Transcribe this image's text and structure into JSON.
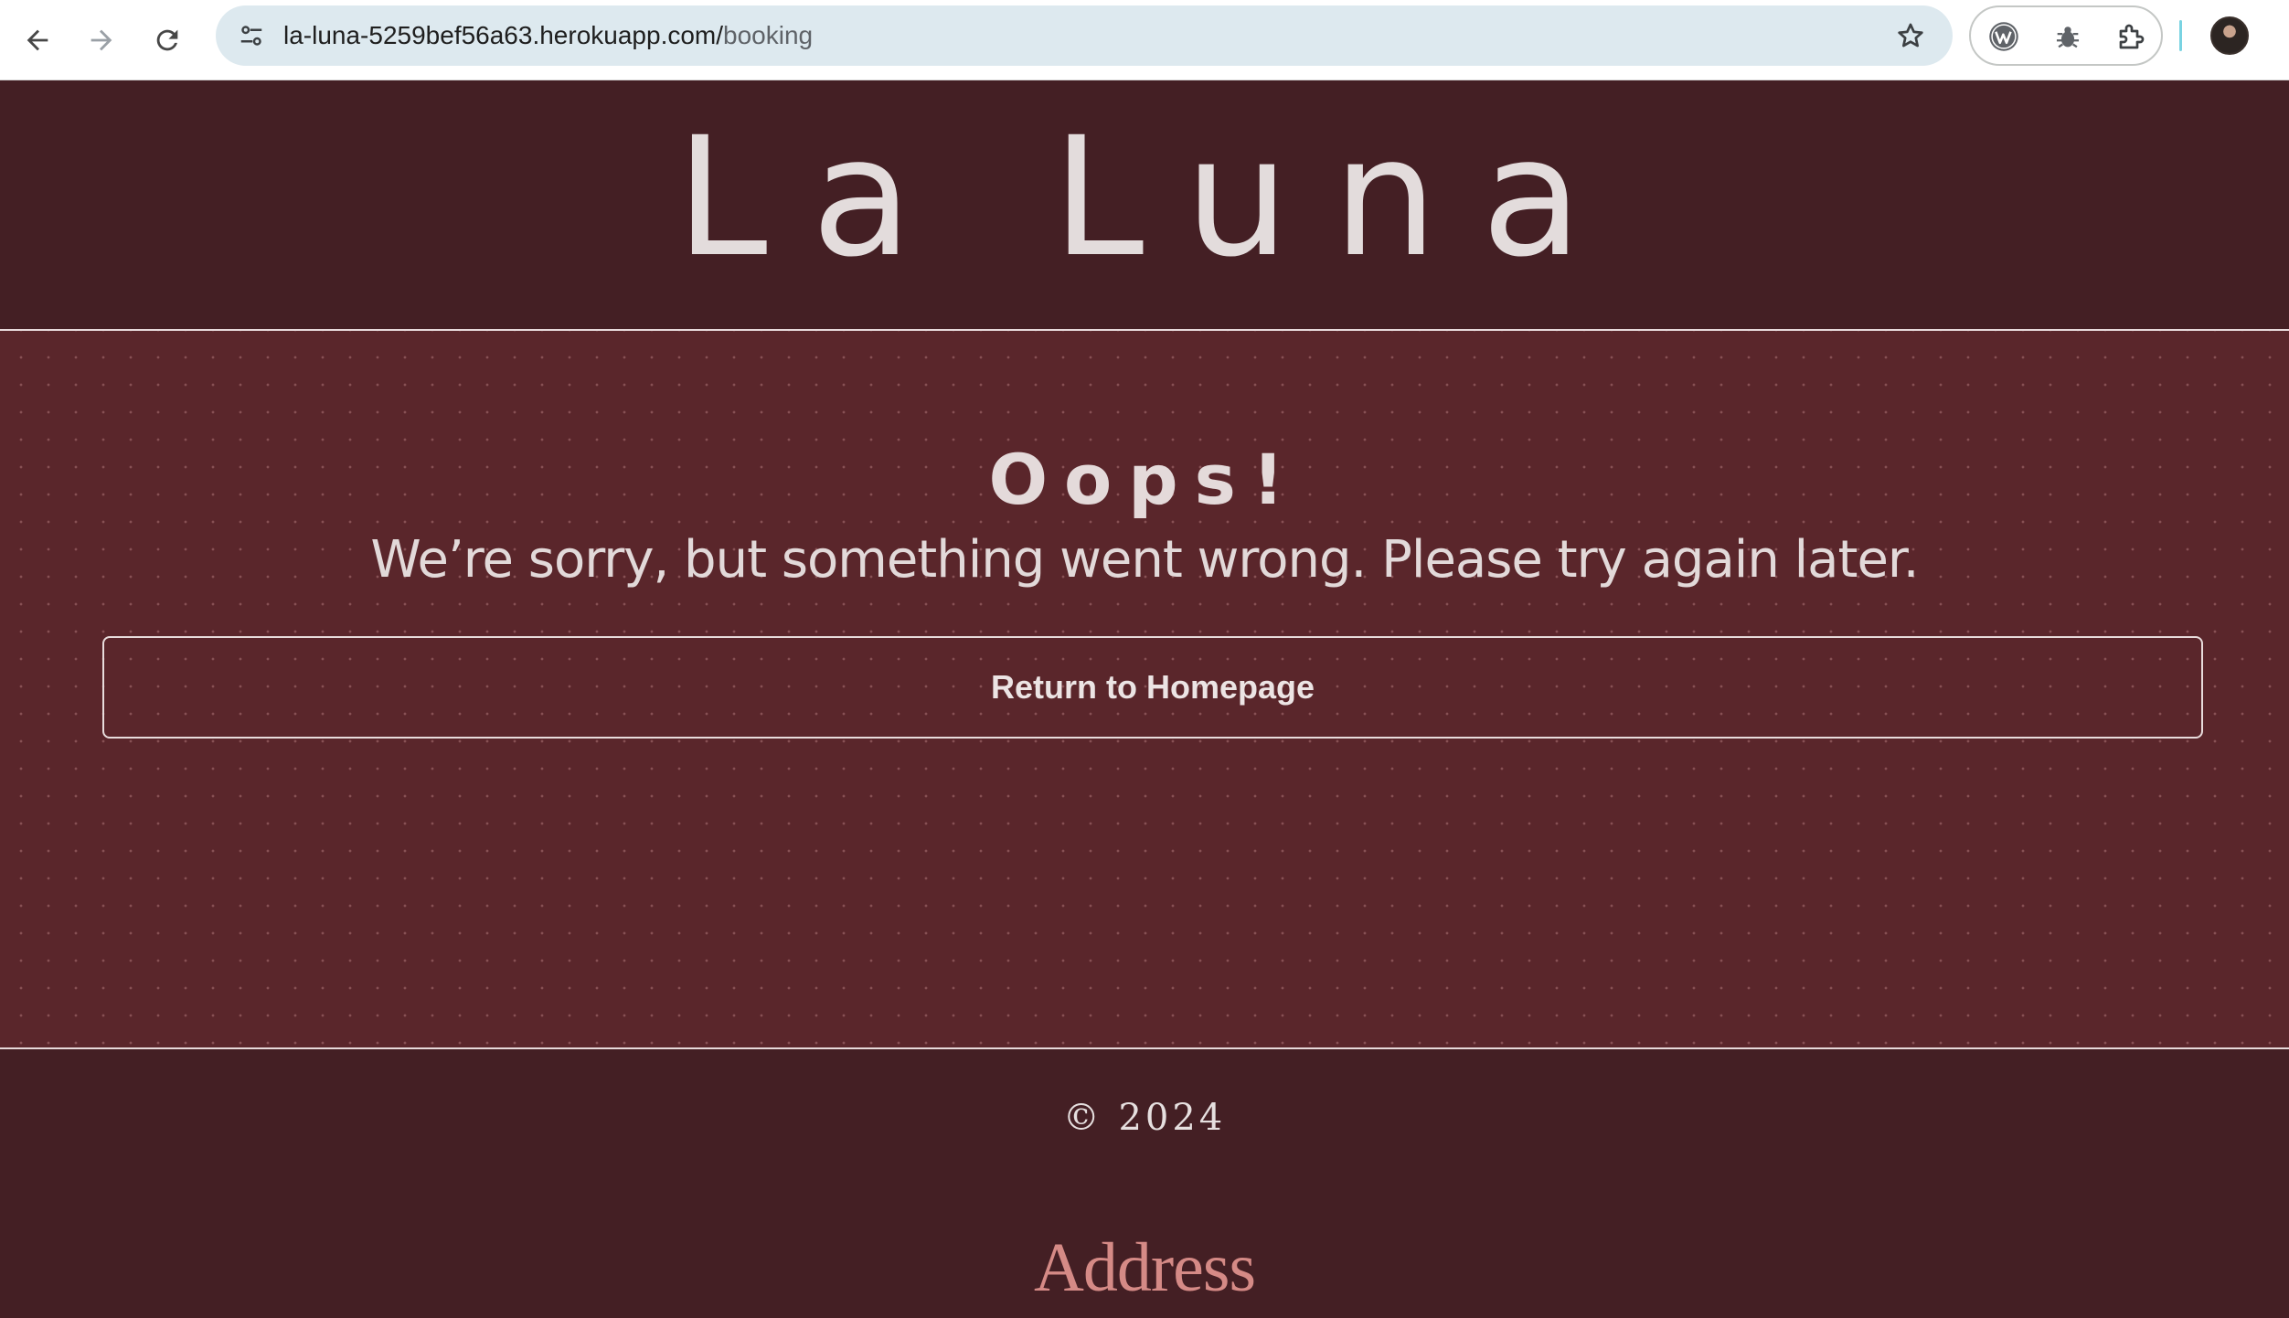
{
  "browser": {
    "url_host": "la-luna-5259bef56a63.herokuapp.com/",
    "url_path": "booking"
  },
  "header": {
    "brand": "La Luna"
  },
  "error": {
    "title": "Oops!",
    "message": "We’re sorry, but something went wrong. Please try again later.",
    "button_label": "Return to Homepage"
  },
  "footer": {
    "copyright": "© 2024",
    "address_heading": "Address"
  },
  "colors": {
    "header_bg": "#441f24",
    "main_bg": "#5a262b",
    "address_accent": "#d58a86"
  }
}
